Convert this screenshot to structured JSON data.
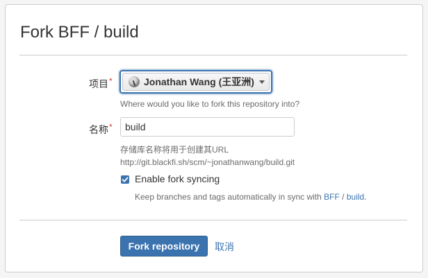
{
  "dialog": {
    "title": "Fork BFF / build"
  },
  "project": {
    "label": "项目",
    "required_mark": "*",
    "selected": "Jonathan Wang (王亚洲)",
    "help": "Where would you like to fork this repository into?"
  },
  "name": {
    "label": "名称",
    "required_mark": "*",
    "value": "build",
    "help_line1": "存储库名称将用于创建其URL",
    "help_line2": "http://git.blackfi.sh/scm/~jonathanwang/build.git"
  },
  "sync": {
    "checked": true,
    "label": "Enable fork syncing",
    "help_prefix": "Keep branches and tags automatically in sync with ",
    "project_link": "BFF",
    "separator": " / ",
    "repo_link": "build",
    "help_suffix": "."
  },
  "actions": {
    "fork_label": "Fork repository",
    "cancel_label": "取消"
  },
  "colors": {
    "accent": "#3b73af",
    "required": "#d04437"
  }
}
